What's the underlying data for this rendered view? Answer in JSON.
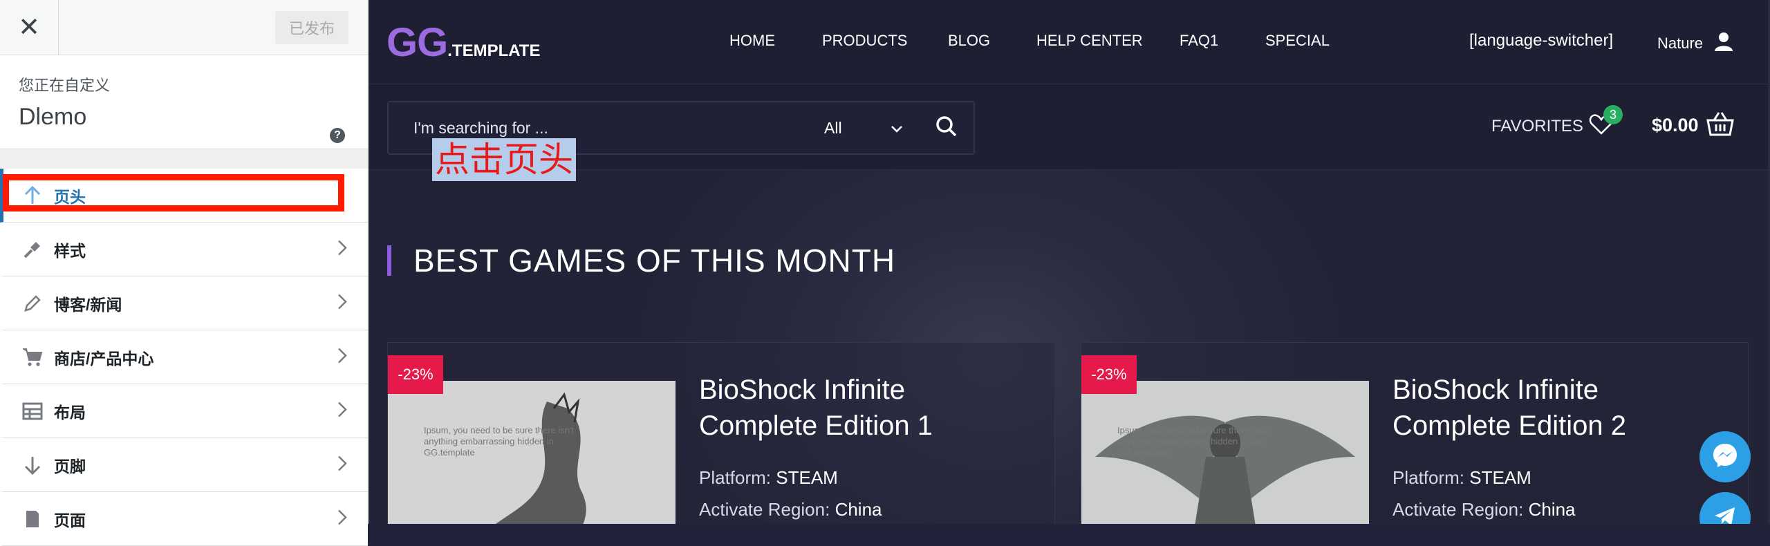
{
  "customizer": {
    "close_label": "✕",
    "publish_label": "已发布",
    "info_small": "您正在自定义",
    "site_name": "Dlemo",
    "help_icon": "?",
    "sections": [
      {
        "label": "页头",
        "icon": "arrow-up-icon"
      },
      {
        "label": "样式",
        "icon": "brush-icon"
      },
      {
        "label": "博客/新闻",
        "icon": "pencil-icon"
      },
      {
        "label": "商店/产品中心",
        "icon": "cart-icon"
      },
      {
        "label": "布局",
        "icon": "table-icon"
      },
      {
        "label": "页脚",
        "icon": "arrow-down-icon"
      },
      {
        "label": "页面",
        "icon": "page-icon"
      }
    ]
  },
  "site": {
    "logo_main": "GG",
    "logo_suffix": ".TEMPLATE",
    "nav": [
      "HOME",
      "PRODUCTS",
      "BLOG",
      "HELP CENTER",
      "FAQ1",
      "SPECIAL"
    ],
    "language_switcher": "[language-switcher]",
    "user_name": "Nature",
    "search_placeholder": "I'm searching for ...",
    "search_category": "All",
    "favorites_label": "FAVORITES",
    "favorites_count": "3",
    "cart_amount": "$0.00",
    "annotation": "点击页头",
    "section_title": "BEST GAMES OF THIS MONTH",
    "cards": [
      {
        "discount": "-23%",
        "title": "BioShock Infinite Complete Edition 1",
        "platform_label": "Platform:",
        "platform": "STEAM",
        "region_label": "Activate Region:",
        "region": "China",
        "thumb_text": "Ipsum, you need to be sure there isn't anything embarrassing hidden in GG.template"
      },
      {
        "discount": "-23%",
        "title": "BioShock Infinite Complete Edition 2",
        "platform_label": "Platform:",
        "platform": "STEAM",
        "region_label": "Activate Region:",
        "region": "China",
        "thumb_text": "Ipsum, you need to be sure there isn't anything embarrassing hidden in the GG.template"
      }
    ]
  },
  "colors": {
    "accent_purple": "#9d6be0",
    "discount_red": "#e5194a",
    "badge_green": "#27ae60",
    "customizer_blue": "#2271b1",
    "annotation_red": "#ff1a00"
  }
}
